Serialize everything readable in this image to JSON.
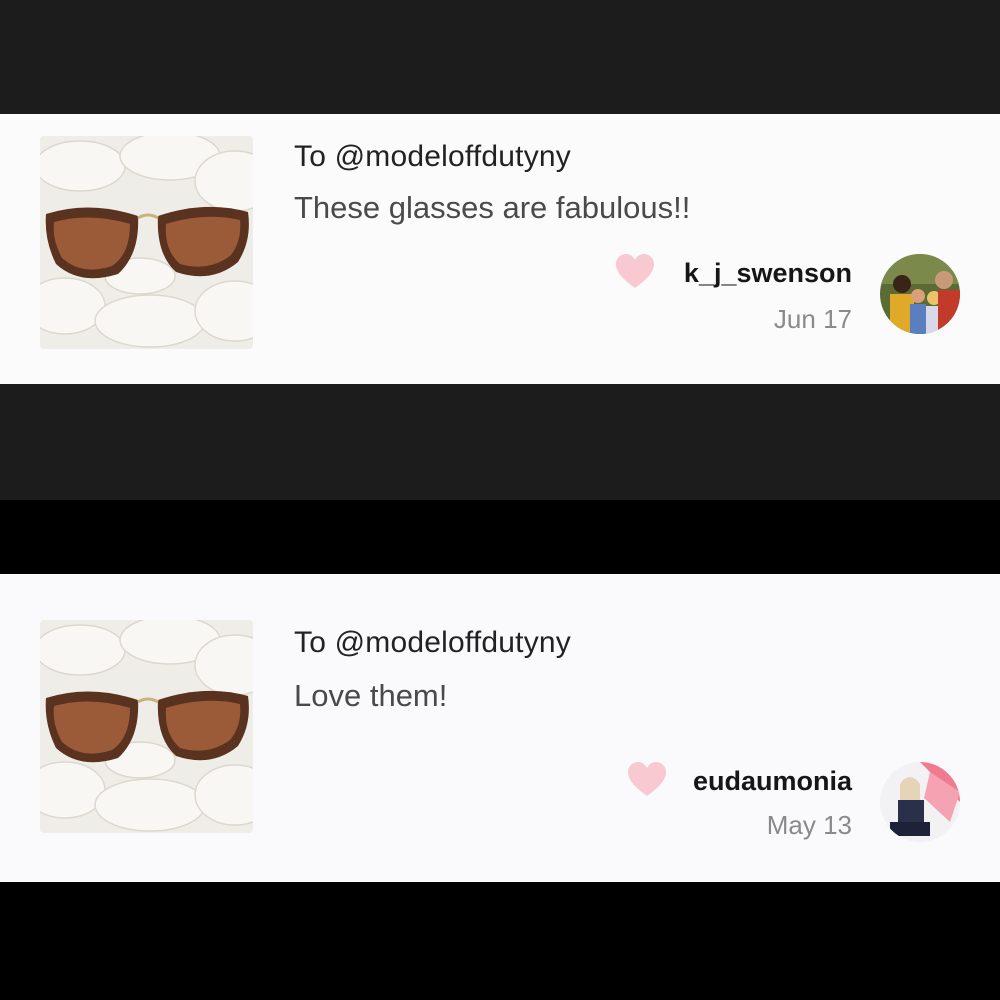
{
  "comments": [
    {
      "to": "To @modeloffdutyny",
      "message": "These glasses are fabulous!!",
      "username": "k_j_swenson",
      "date": "Jun 17",
      "liked": true,
      "thumbnail_icon": "sunglasses-photo",
      "avatar_icon": "family-photo-avatar"
    },
    {
      "to": "To @modeloffdutyny",
      "message": "Love them!",
      "username": "eudaumonia",
      "date": "May 13",
      "liked": true,
      "thumbnail_icon": "sunglasses-photo",
      "avatar_icon": "person-photo-avatar"
    }
  ],
  "colors": {
    "heart": "#f9c9d2",
    "card_bg": "#fbfbfb",
    "band_dark": "#1c1c1c",
    "band_black": "#000000",
    "date_text": "#8a8a8a"
  }
}
